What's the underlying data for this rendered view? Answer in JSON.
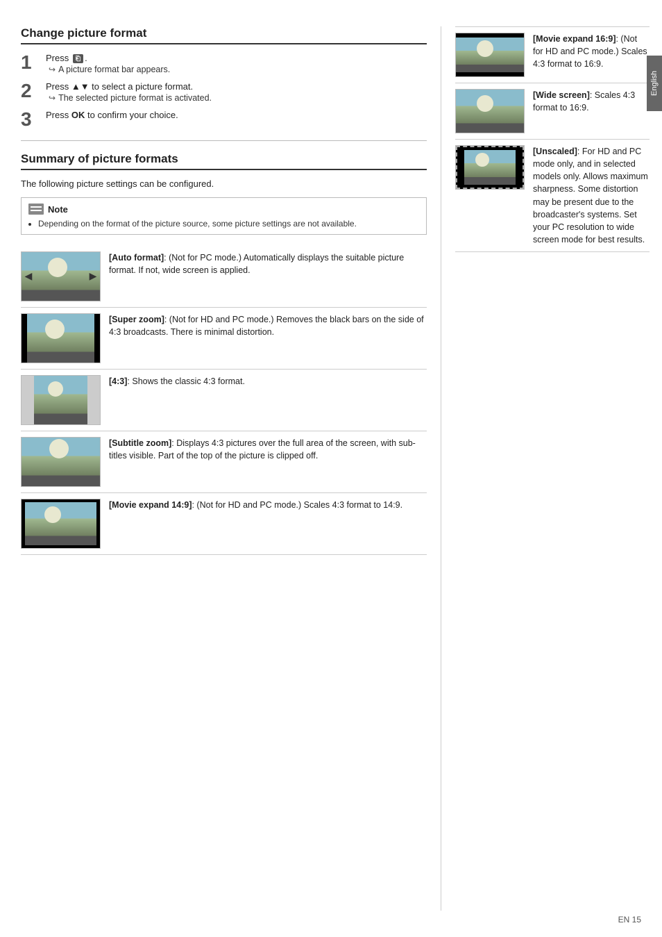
{
  "page": {
    "side_tab": "English",
    "footer": "EN  15"
  },
  "left": {
    "section1_title": "Change picture format",
    "step1": {
      "number": "1",
      "action": "Press",
      "key": "⊞",
      "sub": "A picture format bar appears."
    },
    "step2": {
      "number": "2",
      "action": "Press ▲▼ to select a picture format.",
      "sub": "The selected picture format is activated."
    },
    "step3": {
      "number": "3",
      "action": "Press",
      "key_bold": "OK",
      "action2": "to confirm your choice."
    },
    "section2_title": "Summary of picture formats",
    "section2_intro": "The following picture settings can be configured.",
    "note_label": "Note",
    "note_text": "Depending on the format of the picture source, some picture settings are not available.",
    "formats": [
      {
        "id": "auto",
        "name": "[Auto format]",
        "desc": ": (Not for PC mode.) Automatically displays the suitable picture format. If not, wide screen is applied."
      },
      {
        "id": "superzoom",
        "name": "[Super zoom]",
        "desc": ": (Not for HD and PC mode.) Removes the black bars on the side of 4:3 broadcasts. There is minimal distortion."
      },
      {
        "id": "43",
        "name": "[4:3]",
        "desc": ": Shows the classic 4:3 format."
      },
      {
        "id": "subtitle",
        "name": "[Subtitle zoom]",
        "desc": ": Displays 4:3 pictures over the full area of the screen, with sub-titles visible. Part of the top of the picture is clipped off."
      },
      {
        "id": "movie149",
        "name": "[Movie expand 14:9]",
        "desc": ": (Not for HD and PC mode.) Scales 4:3 format to 14:9."
      }
    ]
  },
  "right": {
    "formats": [
      {
        "id": "movie169",
        "name": "[Movie expand 16:9]",
        "desc": ": (Not for HD and PC mode.) Scales 4:3 format to 16:9."
      },
      {
        "id": "widescreen",
        "name": "[Wide screen]",
        "desc": ": Scales 4:3 format to 16:9."
      },
      {
        "id": "unscaled",
        "name": "[Unscaled]",
        "desc": ": For HD and PC mode only, and in selected models only. Allows maximum sharpness. Some distortion may be present due to the broadcaster's systems. Set your PC resolution to wide screen mode for best results."
      }
    ]
  }
}
